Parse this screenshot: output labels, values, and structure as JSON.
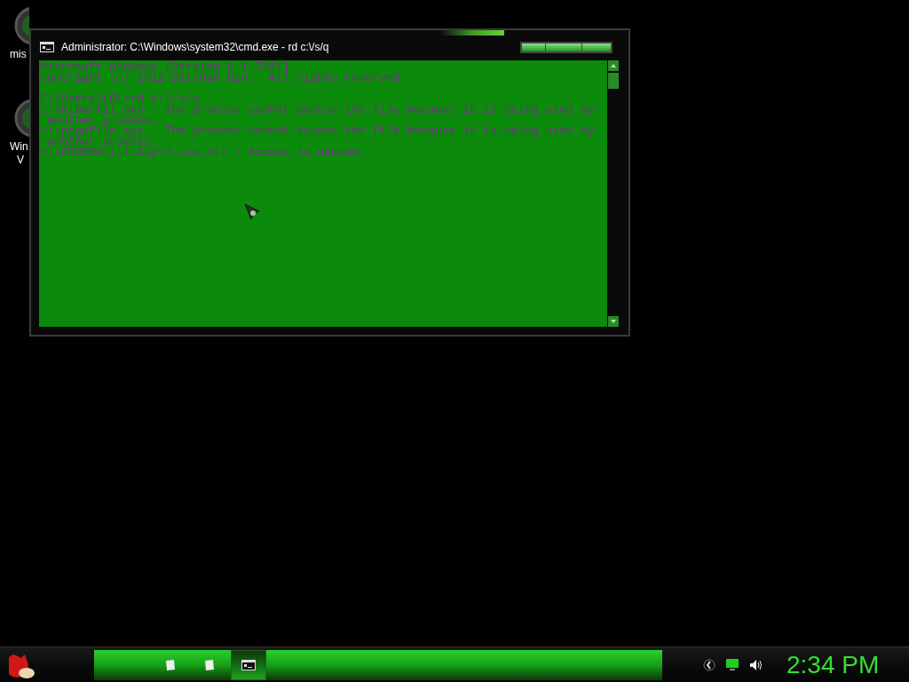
{
  "desktop_icons": [
    {
      "label_lines": [
        "mis"
      ]
    },
    {
      "label_lines": [
        "Win",
        "V"
      ]
    }
  ],
  "window": {
    "title": "Administrator: C:\\Windows\\system32\\cmd.exe - rd  c:\\/s/q",
    "console_blocks": [
      [
        "Microsoft Windows [Version 6.1.7601]",
        "Copyright (c) 2012 Dilshad Ego.  All rights reserved."
      ],
      [
        "C:\\Users\\LOL>rd c:\\/s/q",
        "c:\\hiberfil.sys - The process cannot access the file because it is being used by",
        " another process.",
        "c:\\pagefile.sys - The process cannot access the file because it is being used by",
        " another process.",
        "c:\\PROGRA~1\\7-Zip\\7-zip.dll - Access is denied."
      ]
    ]
  },
  "taskbar": {
    "tasks": [
      {
        "kind": "page",
        "selected": false
      },
      {
        "kind": "page",
        "selected": false
      },
      {
        "kind": "console",
        "selected": true
      }
    ],
    "clock": "2:34 PM"
  }
}
